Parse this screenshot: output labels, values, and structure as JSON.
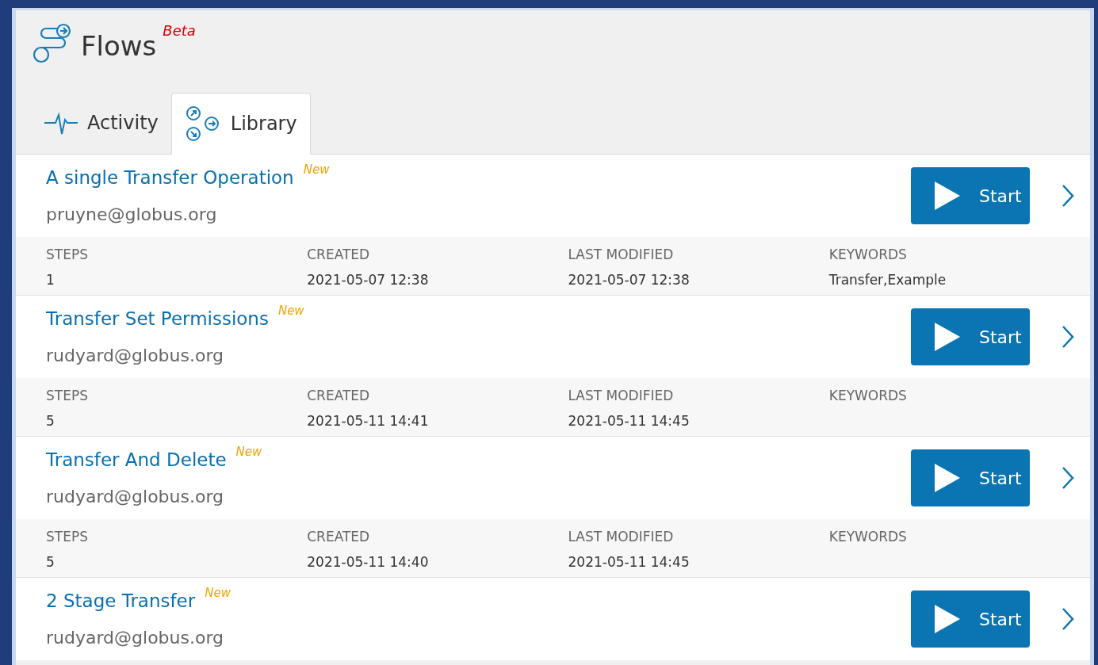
{
  "app": {
    "title": "Flows",
    "badge": "Beta"
  },
  "tabs": [
    {
      "label": "Activity",
      "selected": false
    },
    {
      "label": "Library",
      "selected": true
    }
  ],
  "flows": [
    {
      "title": "A single Transfer Operation",
      "badge": "New",
      "author": "pruyne@globus.org",
      "button": "Start",
      "fields": [
        {
          "label": "STEPS",
          "value": "1"
        },
        {
          "label": "CREATED",
          "value": "2021-05-07 12:38"
        },
        {
          "label": "LAST MODIFIED",
          "value": "2021-05-07 12:38"
        },
        {
          "label": "KEYWORDS",
          "value": "Transfer,Example"
        }
      ]
    },
    {
      "title": "Transfer Set Permissions",
      "badge": "New",
      "author": "rudyard@globus.org",
      "button": "Start",
      "fields": [
        {
          "label": "STEPS",
          "value": "5"
        },
        {
          "label": "CREATED",
          "value": "2021-05-11 14:41"
        },
        {
          "label": "LAST MODIFIED",
          "value": "2021-05-11 14:45"
        },
        {
          "label": "KEYWORDS"
        }
      ]
    },
    {
      "title": "Transfer And Delete",
      "badge": "New",
      "author": "rudyard@globus.org",
      "button": "Start",
      "fields": [
        {
          "label": "STEPS",
          "value": "5"
        },
        {
          "label": "CREATED",
          "value": "2021-05-11 14:40"
        },
        {
          "label": "LAST MODIFIED",
          "value": "2021-05-11 14:45"
        },
        {
          "label": "KEYWORDS"
        }
      ]
    },
    {
      "title": "2 Stage Transfer",
      "badge": "New",
      "author": "rudyard@globus.org",
      "button": "Start"
    }
  ]
}
